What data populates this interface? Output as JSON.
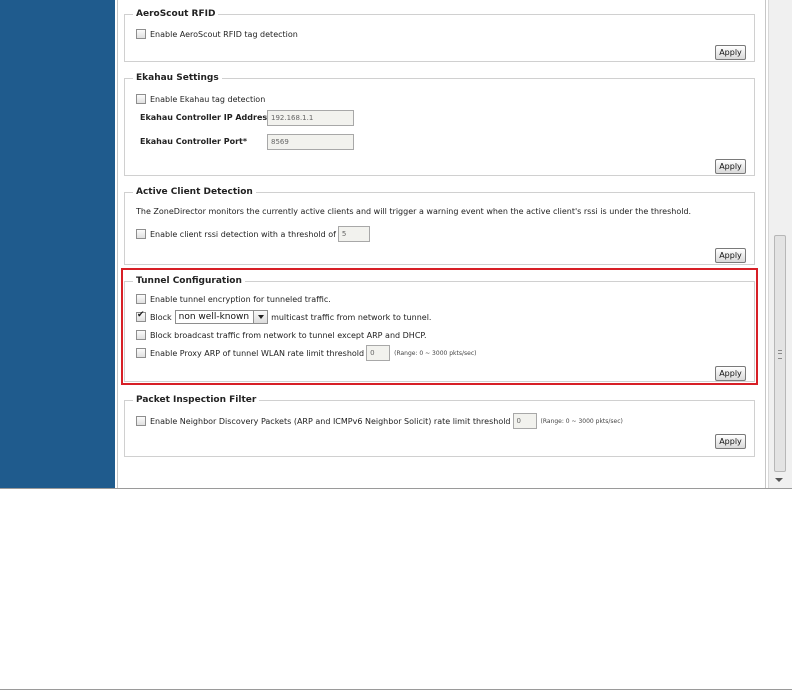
{
  "aeroscout": {
    "legend": "AeroScout RFID",
    "enable_label": "Enable AeroScout RFID tag detection",
    "apply": "Apply"
  },
  "ekahau": {
    "legend": "Ekahau Settings",
    "enable_label": "Enable Ekahau tag detection",
    "ip_label": "Ekahau Controller IP Address*",
    "ip_value": "192.168.1.1",
    "port_label": "Ekahau Controller Port*",
    "port_value": "8569",
    "apply": "Apply"
  },
  "active_client": {
    "legend": "Active Client Detection",
    "description": "The ZoneDirector monitors the currently active clients and will trigger a warning event when the active client's rssi is under the threshold.",
    "enable_label": "Enable client rssi detection with a threshold of",
    "threshold_value": "5",
    "apply": "Apply"
  },
  "tunnel": {
    "legend": "Tunnel Configuration",
    "encryption_label": "Enable tunnel encryption for tunneled traffic.",
    "block_label": "Block",
    "block_select_value": "non well-known",
    "block_suffix": "multicast traffic from network to tunnel.",
    "broadcast_label": "Block broadcast traffic from network to tunnel except ARP and DHCP.",
    "proxy_label": "Enable Proxy ARP of tunnel WLAN rate limit threshold",
    "proxy_value": "0",
    "proxy_range": "(Range: 0 ~ 3000 pkts/sec)",
    "apply": "Apply",
    "block_checked": true
  },
  "packet_inspection": {
    "legend": "Packet Inspection Filter",
    "nd_label": "Enable Neighbor Discovery Packets (ARP and ICMPv6 Neighbor Solicit) rate limit threshold",
    "nd_value": "0",
    "nd_range": "(Range: 0 ~ 3000 pkts/sec)",
    "apply": "Apply"
  },
  "colors": {
    "nav_blue": "#1f5b8d",
    "highlight_red": "#d71f26"
  }
}
